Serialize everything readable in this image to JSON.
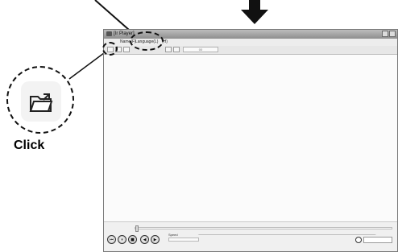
{
  "app": {
    "window_title": "[Ir Player]",
    "menu": [
      "Name(F)",
      "Language(L)",
      "(H)"
    ]
  },
  "toolbar": {
    "field_text": "00"
  },
  "bottom_bar": {
    "speed_label": "Speed"
  },
  "annotation": {
    "click_label": "Click"
  },
  "icons": {
    "open_folder": "open-folder-icon"
  }
}
